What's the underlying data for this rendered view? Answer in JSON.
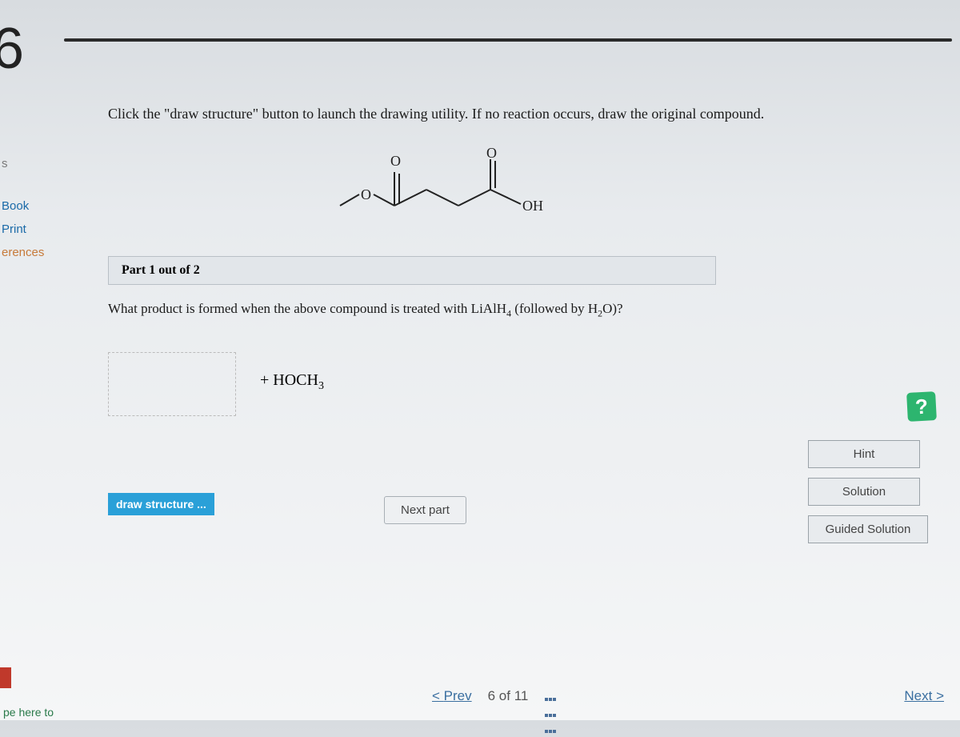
{
  "question_number": "6",
  "sidebar": {
    "items": [
      {
        "label": "s"
      },
      {
        "label": "Book"
      },
      {
        "label": "Print"
      },
      {
        "label": "erences"
      }
    ]
  },
  "prompt": "Click the \"draw structure\" button to launch the drawing utility. If no reaction occurs, draw the original compound.",
  "molecule": {
    "left_label": "O",
    "right_label": "OH",
    "top_o1": "O",
    "top_o2": "O"
  },
  "part_label": "Part 1 out of 2",
  "question_html": "What product is formed when the above compound is treated with LiAlH₄ (followed by H₂O)?",
  "byproduct": "+ HOCH₃",
  "buttons": {
    "draw": "draw structure ...",
    "next_part": "Next part",
    "hint": "Hint",
    "solution": "Solution",
    "guided": "Guided Solution",
    "help_icon": "?"
  },
  "nav": {
    "prev": "Prev",
    "count": "6 of 11",
    "next": "Next"
  },
  "bottom_fragment": "pe here to"
}
